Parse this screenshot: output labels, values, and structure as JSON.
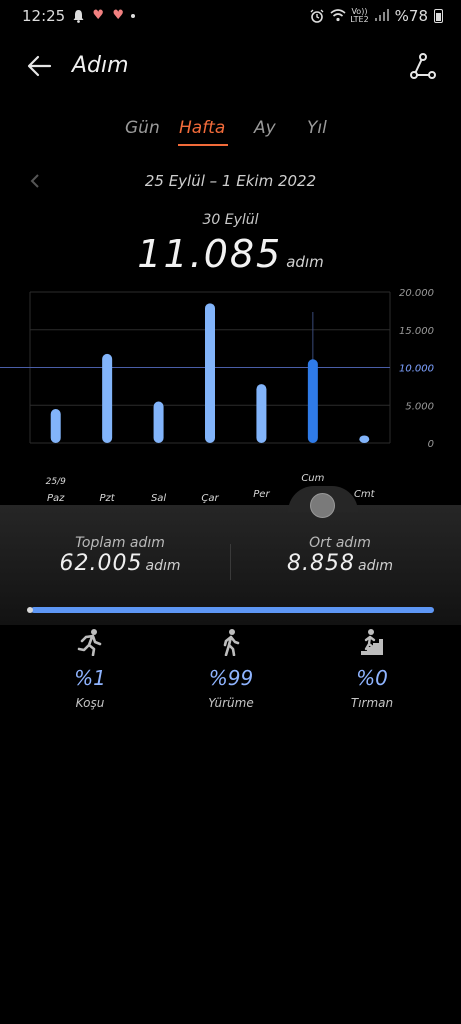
{
  "status_bar": {
    "time": "12:25",
    "network": "Vo))\nLTE2",
    "battery": "%78"
  },
  "app_bar": {
    "title": "Adım"
  },
  "tabs": [
    {
      "label": "Gün",
      "active": false
    },
    {
      "label": "Hafta",
      "active": true
    },
    {
      "label": "Ay",
      "active": false
    },
    {
      "label": "Yıl",
      "active": false
    }
  ],
  "range": {
    "label": "25 Eylül – 1 Ekim 2022"
  },
  "selected": {
    "day": "30 Eylül",
    "steps": "11.085",
    "unit": "adım"
  },
  "chart_data": {
    "type": "bar",
    "categories": [
      "Paz",
      "Pzt",
      "Sal",
      "Çar",
      "Per",
      "Cum",
      "Cmt"
    ],
    "values": [
      4500,
      11800,
      5500,
      18500,
      7800,
      11085,
      1000
    ],
    "selected_index": 5,
    "first_date_label": "25/9",
    "y_ticks": [
      "20.000",
      "15.000",
      "10.000",
      "5.000",
      "0"
    ],
    "y_tick_values": [
      20000,
      15000,
      10000,
      5000,
      0
    ],
    "average": 8858,
    "average_label": "10.000",
    "ylim": [
      0,
      20000
    ],
    "bar_color": "#82b4fa",
    "selected_color": "#2f7be8",
    "grid": true
  },
  "stats": {
    "total_label": "Toplam adım",
    "total_value": "62.005",
    "avg_label": "Ort adım",
    "avg_value": "8.858",
    "unit": "adım"
  },
  "progress": {
    "fill_fraction": 0.99
  },
  "activities": [
    {
      "icon": "running-icon",
      "pct": "%1",
      "label": "Koşu"
    },
    {
      "icon": "walking-icon",
      "pct": "%99",
      "label": "Yürüme"
    },
    {
      "icon": "climbing-icon",
      "pct": "%0",
      "label": "Tırman"
    }
  ],
  "colors": {
    "accent": "#f26b3a",
    "bar": "#82b4fa",
    "bar_selected": "#2f7be8",
    "pct": "#8fb4ff"
  }
}
